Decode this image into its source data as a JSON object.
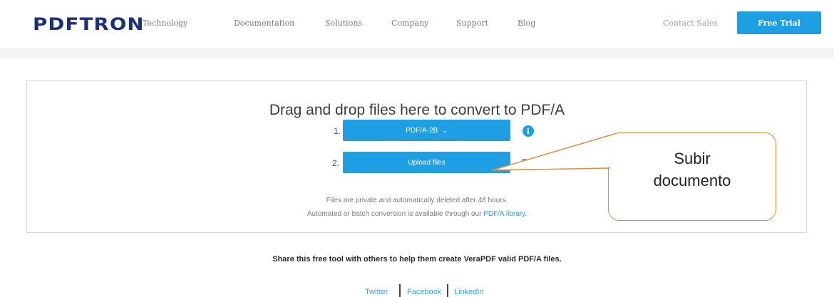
{
  "header": {
    "logo": "PDFTRON",
    "nav": [
      "Technology",
      "Documentation",
      "Solutions",
      "Company",
      "Support",
      "Blog"
    ],
    "contact": "Contact Sales",
    "cta": "Free Trial"
  },
  "main": {
    "title": "Drag and drop files here to convert to PDF/A",
    "step1_num": "1.",
    "step1_value": "PDF/A-2B",
    "step2_num": "2.",
    "step2_label": "Upload files",
    "info_glyph": "i",
    "note_line1": "Files are private and automatically deleted after 48 hours.",
    "note_line2": "Automated or batch conversion is available through our",
    "note_link": "PDF/A library",
    "note_end": "."
  },
  "callout": {
    "text": "Subir\ndocumento"
  },
  "share": {
    "text": "Share this free tool with others to help them create VeraPDF valid PDF/A files.",
    "links": [
      "Twitter",
      "Facebook",
      "LinkedIn"
    ]
  },
  "colors": {
    "accent": "#1e9fe3",
    "callout_border": "#e08a3c",
    "logo": "#1d2f7a"
  },
  "icons": {
    "info": "info-icon",
    "folder": "folder-icon",
    "caret": "chevron-down-icon"
  }
}
